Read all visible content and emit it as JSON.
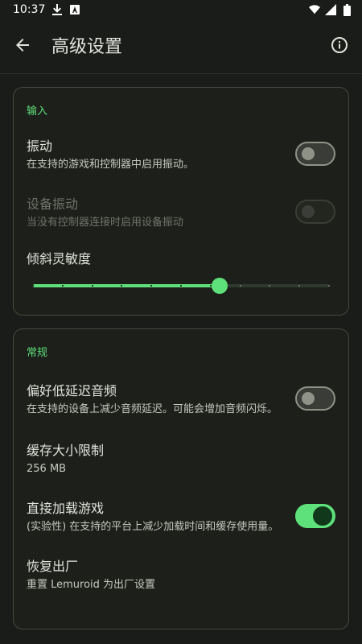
{
  "status_bar": {
    "time": "10:37"
  },
  "app_bar": {
    "title": "高级设置"
  },
  "input_section": {
    "title": "输入",
    "vibration": {
      "label": "振动",
      "summary": "在支持的游戏和控制器中启用振动。",
      "enabled": false
    },
    "device_vibration": {
      "label": "设备振动",
      "summary": "当没有控制器连接时启用设备振动",
      "enabled": false,
      "disabled": true
    },
    "tilt_sensitivity": {
      "label": "倾斜灵敏度",
      "value": 0.63,
      "steps": 10
    }
  },
  "general_section": {
    "title": "常规",
    "low_latency_audio": {
      "label": "偏好低延迟音频",
      "summary": "在支持的设备上减少音频延迟。可能会增加音频闪烁。",
      "enabled": false
    },
    "cache_size": {
      "label": "缓存大小限制",
      "value": "256 MB"
    },
    "direct_load": {
      "label": "直接加载游戏",
      "summary": "(实验性) 在支持的平台上减少加载时间和缓存使用量。",
      "enabled": true
    },
    "reset": {
      "label": "恢复出厂",
      "summary": "重置 Lemuroid 为出厂设置"
    }
  },
  "colors": {
    "accent": "#5ee07a",
    "background": "#1a1c19"
  }
}
